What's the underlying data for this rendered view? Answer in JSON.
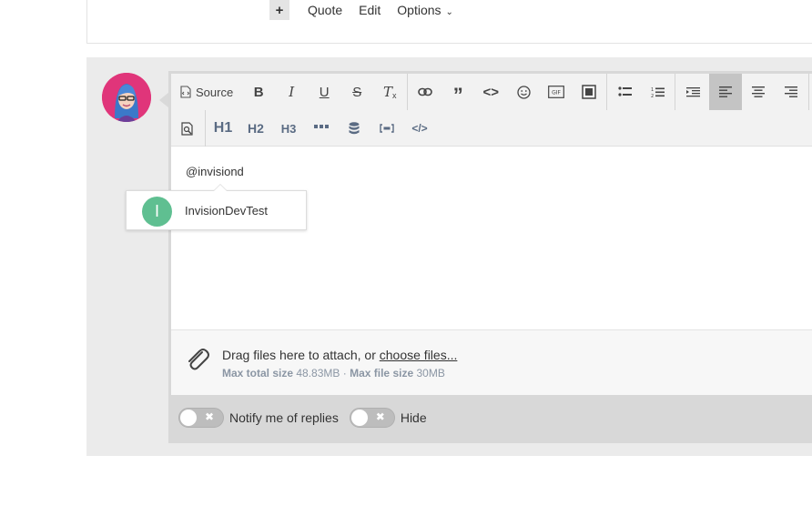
{
  "post_actions": {
    "plus_label": "+",
    "quote_label": "Quote",
    "edit_label": "Edit",
    "options_label": "Options"
  },
  "toolbar": {
    "source_label": "Source",
    "row1_icons": [
      "bold-icon",
      "italic-icon",
      "underline-icon",
      "strikethrough-icon",
      "remove-format-icon",
      "link-icon",
      "blockquote-icon",
      "code-icon",
      "emoji-icon",
      "gif-icon",
      "media-icon",
      "bulleted-list-icon",
      "numbered-list-icon",
      "indent-icon",
      "align-left-icon",
      "align-center-icon",
      "align-right-icon"
    ],
    "h1_label": "H1",
    "h2_label": "H2",
    "h3_label": "H3"
  },
  "editor": {
    "content_text": "@invisiond"
  },
  "mention": {
    "avatar_letter": "I",
    "name": "InvisionDevTest",
    "avatar_color": "#5fbf91"
  },
  "attach": {
    "drag_text": "Drag files here to attach, or ",
    "choose_text": "choose files...",
    "max_total_label": "Max total size",
    "max_total_value": "48.83MB",
    "separator": "·",
    "max_file_label": "Max file size",
    "max_file_value": "30MB"
  },
  "footer": {
    "notify_label": "Notify me of replies",
    "hide_label": "Hide",
    "toggle_off_glyph": "✖"
  }
}
